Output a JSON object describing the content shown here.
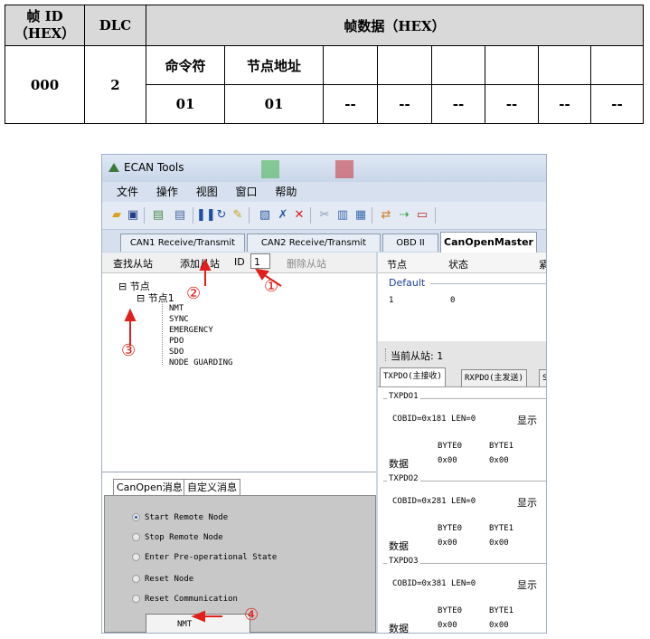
{
  "frame_table": {
    "header": {
      "frame_id": "帧 ID\n（HEX）",
      "dlc": "DLC",
      "data": "帧数据（HEX）"
    },
    "row": {
      "frame_id": "000",
      "dlc": "2",
      "cmd_label": "命令符",
      "addr_label": "节点地址",
      "cmd_value": "01",
      "addr_value": "01",
      "empty_cells": [
        "--",
        "--",
        "--",
        "--",
        "--",
        "--"
      ]
    }
  },
  "window": {
    "title": "ECAN Tools",
    "menu": [
      "文件",
      "操作",
      "视图",
      "窗口",
      "帮助"
    ],
    "tabs": [
      "CAN1 Receive/Transmit",
      "CAN2 Receive/Transmit",
      "OBD II",
      "CanOpenMaster"
    ],
    "left_toolbar": {
      "find": "查找从站",
      "add": "添加从站",
      "id_label": "ID",
      "id_value": "1",
      "delete": "删除从站"
    },
    "tree": {
      "root": "节点",
      "node": "节点1",
      "children": [
        "NMT",
        "SYNC",
        "EMERGENCY",
        "PDO",
        "SDO",
        "NODE GUARDING"
      ]
    },
    "msg_tabs": [
      "CanOpen消息",
      "自定义消息"
    ],
    "radio_options": [
      "Start Remote Node",
      "Stop Remote Node",
      "Enter Pre-operational State",
      "Reset Node",
      "Reset Communication"
    ],
    "selected_option": "Start Remote Node",
    "nmt_button": "NMT",
    "node_table": {
      "col_node": "节点",
      "col_state": "状态",
      "col_extra": "紧",
      "group": "Default",
      "rows": [
        {
          "node": "1",
          "state": "0"
        }
      ]
    },
    "current_slave": "当前从站: 1",
    "pdo_tabs": [
      "TXPDO(主接收)",
      "RXPDO(主发送)",
      "S"
    ],
    "pdo_groups": [
      {
        "title": "TXPDO1",
        "cobid": "COBID=0x181 LEN=0",
        "show": "显示",
        "byte0": "BYTE0",
        "byte1": "BYTE1",
        "data_label": "数据",
        "val0": "0x00",
        "val1": "0x00"
      },
      {
        "title": "TXPDO2",
        "cobid": "COBID=0x281 LEN=0",
        "show": "显示",
        "byte0": "BYTE0",
        "byte1": "BYTE1",
        "data_label": "数据",
        "val0": "0x00",
        "val1": "0x00"
      },
      {
        "title": "TXPDO3",
        "cobid": "COBID=0x381 LEN=0",
        "show": "显示",
        "byte0": "BYTE0",
        "byte1": "BYTE1",
        "data_label": "数据",
        "val0": "0x00",
        "val1": "0x00"
      }
    ]
  },
  "annotations": [
    "①",
    "②",
    "③",
    "④"
  ],
  "colors": {
    "annotation": "#e0201a",
    "selected_radio": "#2d5aa8"
  }
}
